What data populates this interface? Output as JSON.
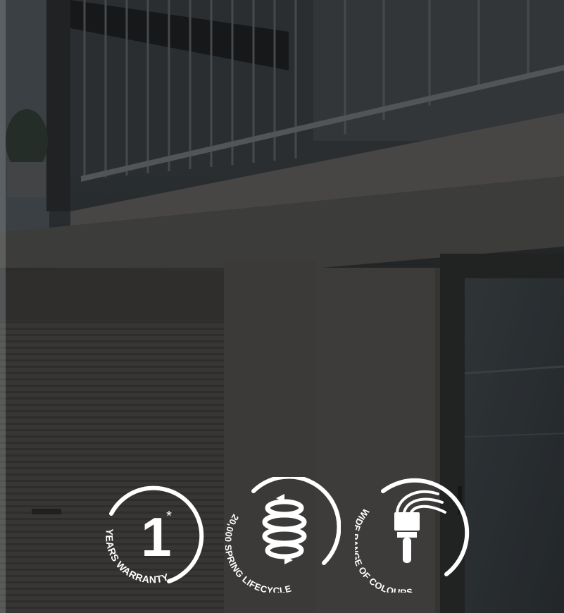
{
  "badges": [
    {
      "number": "1",
      "asterisk": "*",
      "caption": "YEARS WARRANTY"
    },
    {
      "caption": "20,000 SPRING LIFECYCLE"
    },
    {
      "caption": "WIDE RANGE OF COLOURS"
    }
  ]
}
